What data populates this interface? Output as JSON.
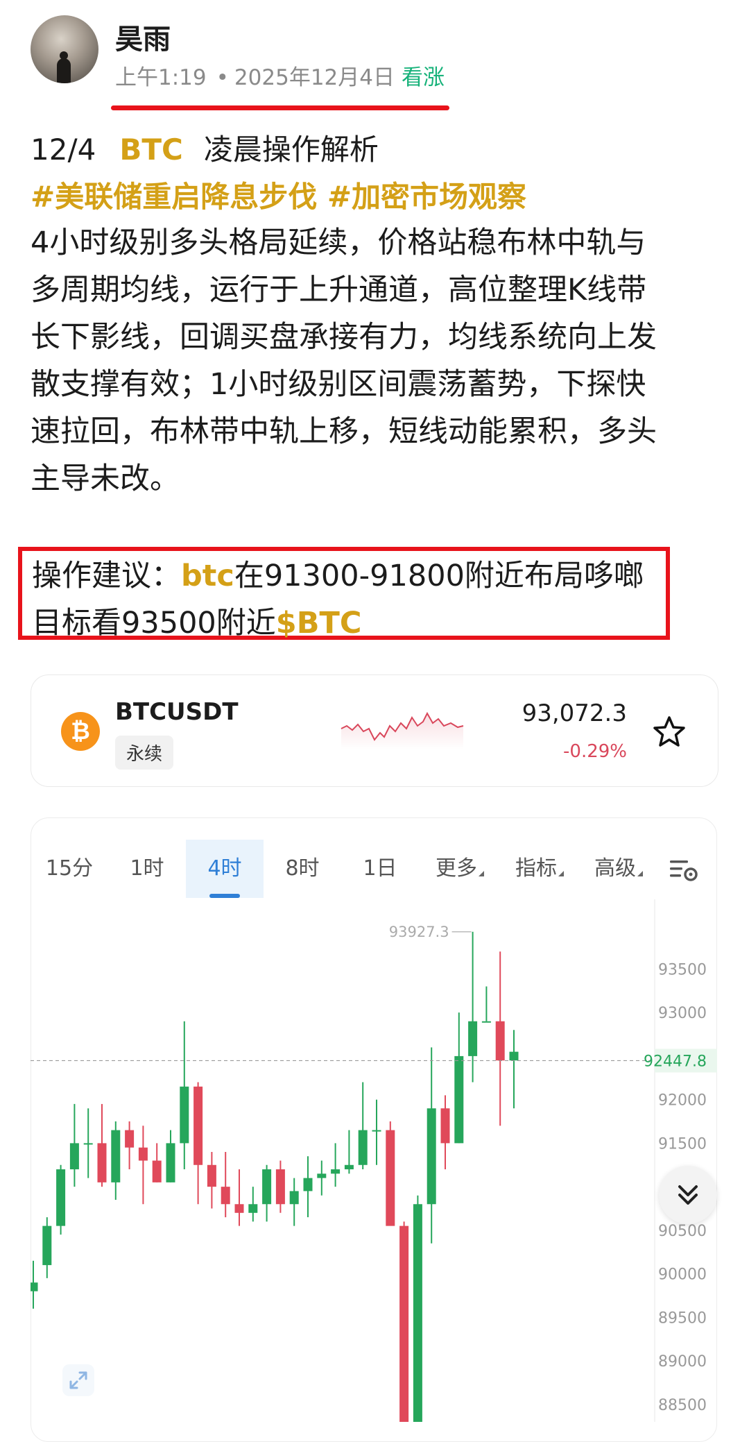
{
  "post": {
    "author": "昊雨",
    "time": "上午1:19",
    "date": "2025年12月4日",
    "sentiment": "看涨",
    "headline_date": "12/4",
    "headline_symbol": "BTC",
    "headline_title": "凌晨操作解析",
    "hashtags": "#美联储重启降息步伐 #加密市场观察",
    "body_lines": [
      "4小时级别多头格局延续，价格站稳布林中轨与",
      "多周期均线，运行于上升通道，高位整理K线带",
      "长下影线，回调买盘承接有力，均线系统向上发",
      "散支撑有效；1小时级别区间震荡蓄势，下探快",
      "速拉回，布林带中轨上移，短线动能累积，多头",
      "主导未改。"
    ],
    "advice_label": "操作建议：",
    "advice_symbol": "btc",
    "advice_line1_rest": "在91300-91800附近布局哆啷",
    "advice_line2": "目标看93500附近",
    "advice_cashtag": "$BTC"
  },
  "ticker": {
    "symbol": "BTCUSDT",
    "type": "永续",
    "price": "93,072.3",
    "change": "-0.29%",
    "logo_glyph": "₿",
    "logo_color": "#f7931a",
    "down_color": "#d9475b"
  },
  "chart": {
    "tabs": [
      "15分",
      "1时",
      "4时",
      "8时",
      "1日",
      "更多",
      "指标",
      "高级"
    ],
    "active_tab": "4时"
  },
  "chart_data": {
    "type": "candlestick",
    "y_ticks": [
      93500,
      93000,
      92000,
      91500,
      90500,
      90000,
      89500,
      89000,
      88500
    ],
    "y_range": [
      88300,
      94300
    ],
    "high_label": "93927.3",
    "last_price_label": "92447.8",
    "up_color": "#26a65b",
    "down_color": "#e0495a",
    "candles": [
      [
        89800,
        90150,
        89600,
        89900
      ],
      [
        90100,
        90650,
        89950,
        90550
      ],
      [
        90550,
        91250,
        90450,
        91200
      ],
      [
        91200,
        91950,
        91000,
        91500
      ],
      [
        91500,
        91900,
        91100,
        91500
      ],
      [
        91500,
        91950,
        91000,
        91050
      ],
      [
        91050,
        91750,
        90850,
        91650
      ],
      [
        91650,
        91750,
        91200,
        91450
      ],
      [
        91450,
        91700,
        90800,
        91300
      ],
      [
        91300,
        91500,
        91050,
        91050
      ],
      [
        91050,
        91650,
        91050,
        91500
      ],
      [
        91500,
        92900,
        91200,
        92150
      ],
      [
        92150,
        92200,
        90800,
        91250
      ],
      [
        91250,
        91400,
        90750,
        91000
      ],
      [
        91000,
        91400,
        90650,
        90800
      ],
      [
        90800,
        91200,
        90550,
        90700
      ],
      [
        90700,
        91000,
        90600,
        90800
      ],
      [
        90800,
        91250,
        90600,
        91200
      ],
      [
        91200,
        91300,
        90700,
        90800
      ],
      [
        90800,
        91100,
        90550,
        90950
      ],
      [
        90950,
        91350,
        90650,
        91100
      ],
      [
        91100,
        91300,
        90900,
        91150
      ],
      [
        91150,
        91500,
        91000,
        91200
      ],
      [
        91200,
        91650,
        91150,
        91250
      ],
      [
        91250,
        92200,
        91200,
        91650
      ],
      [
        91650,
        92000,
        91250,
        91650
      ],
      [
        91650,
        91750,
        90600,
        90550
      ],
      [
        90550,
        90600,
        87800,
        88000
      ],
      [
        88000,
        90900,
        87900,
        90800
      ],
      [
        90800,
        92600,
        90350,
        91900
      ],
      [
        91900,
        92050,
        91200,
        91500
      ],
      [
        91500,
        93000,
        91500,
        92500
      ],
      [
        92500,
        93927.3,
        92200,
        92900
      ],
      [
        92900,
        93300,
        92900,
        92900
      ],
      [
        92900,
        93700,
        91700,
        92450
      ],
      [
        92450,
        92800,
        91900,
        92550
      ]
    ]
  },
  "icons": {
    "star": "star-icon",
    "settings": "chart-settings-icon",
    "scroll": "double-chevron-down-icon",
    "expand": "expand-icon"
  }
}
